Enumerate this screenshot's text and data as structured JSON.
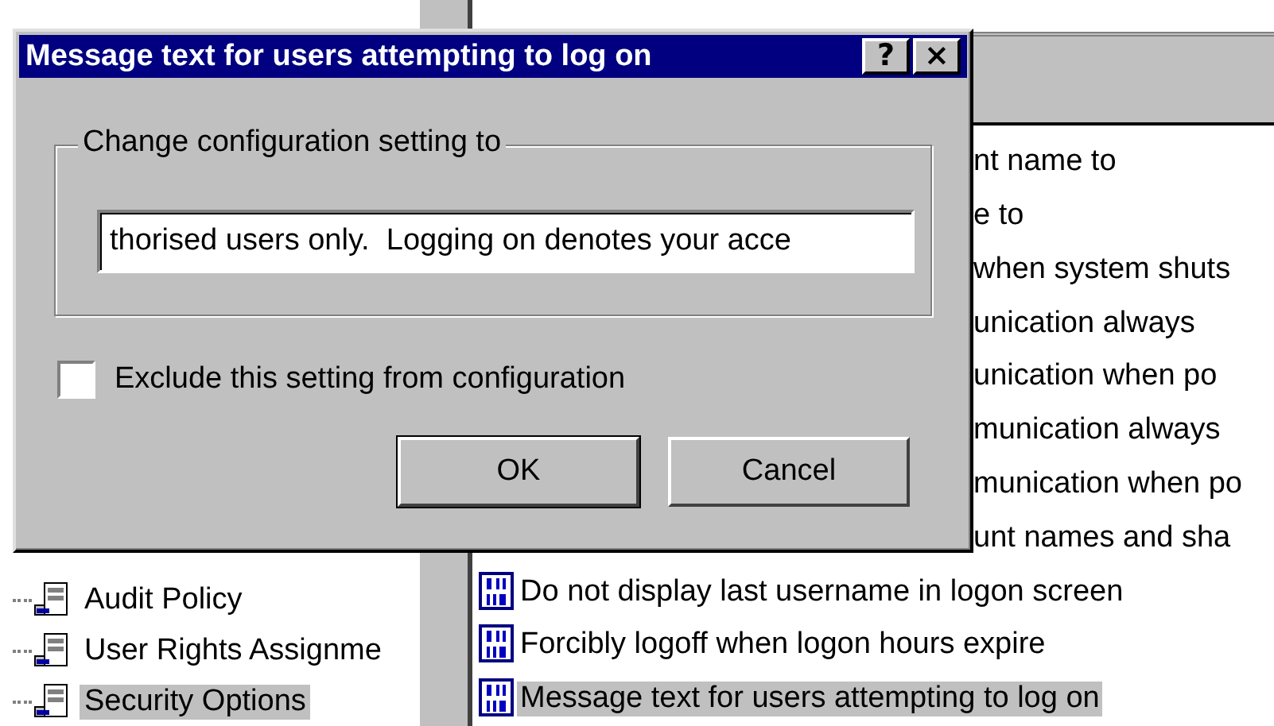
{
  "tree": {
    "items": [
      {
        "label": "Audit Policy",
        "selected": false
      },
      {
        "label": "User Rights Assignme",
        "selected": false
      },
      {
        "label": "Security Options",
        "selected": true
      }
    ]
  },
  "list": {
    "rows": [
      {
        "kind": "covered",
        "label": "nt name to",
        "selected": false
      },
      {
        "kind": "covered",
        "label": "e to",
        "selected": false
      },
      {
        "kind": "covered",
        "label": "when system shuts",
        "selected": false
      },
      {
        "kind": "covered",
        "label": "unication always",
        "selected": false
      },
      {
        "kind": "covered",
        "label": "unication when po",
        "selected": false
      },
      {
        "kind": "covered",
        "label": "munication always",
        "selected": false
      },
      {
        "kind": "covered",
        "label": "munication when po",
        "selected": false
      },
      {
        "kind": "covered",
        "label": "unt names and sha",
        "selected": false
      },
      {
        "kind": "full",
        "label": "Do not display last username in logon screen",
        "selected": false
      },
      {
        "kind": "full",
        "label": "Forcibly logoff when logon hours expire",
        "selected": false
      },
      {
        "kind": "full",
        "label": "Message text for users attempting to log on",
        "selected": true
      }
    ]
  },
  "dialog": {
    "title": "Message text for users attempting to log on",
    "help_button": "?",
    "close_button": "×",
    "group_label": "Change configuration setting to",
    "value": "thorised users only.  Logging on denotes your acce",
    "exclude": {
      "label": "Exclude this setting from configuration",
      "checked": false
    },
    "buttons": [
      "OK",
      "Cancel"
    ]
  }
}
